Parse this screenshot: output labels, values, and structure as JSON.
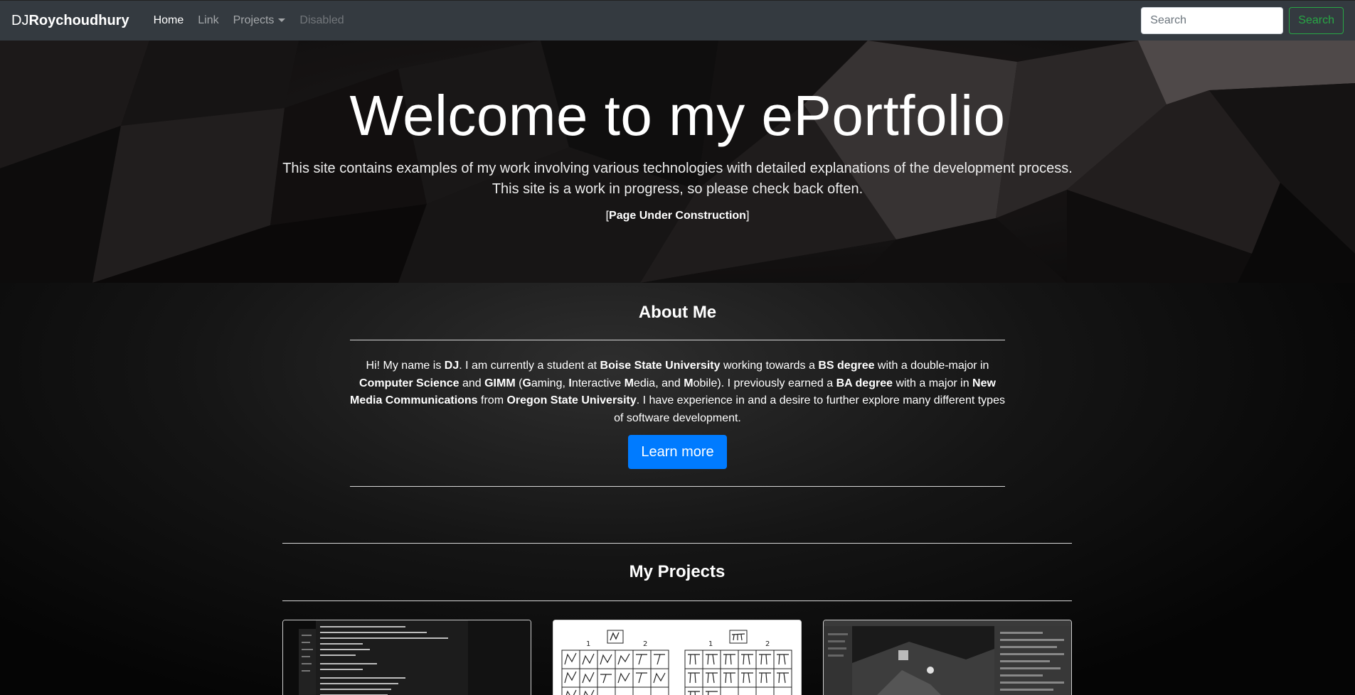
{
  "navbar": {
    "brand_prefix": "DJ",
    "brand_bold": "Roychoudhury",
    "items": [
      {
        "label": "Home"
      },
      {
        "label": "Link"
      },
      {
        "label": "Projects"
      },
      {
        "label": "Disabled"
      }
    ],
    "search_placeholder": "Search",
    "search_button": "Search"
  },
  "hero": {
    "title_light": "Welcome to my ",
    "title_bold": "ePortfolio",
    "lead_line1": "This site contains examples of my work involving various technologies with detailed explanations of the development process.",
    "lead_line2": "This site is a work in progress, so please check back often.",
    "note_open": "[",
    "note_bold": "Page Under Construction",
    "note_close": "]"
  },
  "about": {
    "title_light": "About ",
    "title_bold": "Me",
    "p": [
      "Hi! My name is ",
      "DJ",
      ". I am currently a student at ",
      "Boise State University",
      " working towards a ",
      "BS degree",
      " with a double-major in ",
      "Computer Science",
      " and ",
      "GIMM",
      " (",
      "G",
      "aming, ",
      "I",
      "nteractive ",
      "M",
      "edia, and ",
      "M",
      "obile). I previously earned a ",
      "BA degree",
      " with a major in ",
      "New Media Communications",
      " from ",
      "Oregon State University",
      ". I have experience in and a desire to further explore many different types of software development."
    ],
    "button": "Learn more"
  },
  "projects": {
    "title_light": "My ",
    "title_bold": "Projects",
    "card_labels": [
      "1",
      "2",
      "1",
      "2"
    ]
  },
  "colors": {
    "navbar": "#343a40",
    "primary": "#007bff",
    "success": "#28a745"
  }
}
